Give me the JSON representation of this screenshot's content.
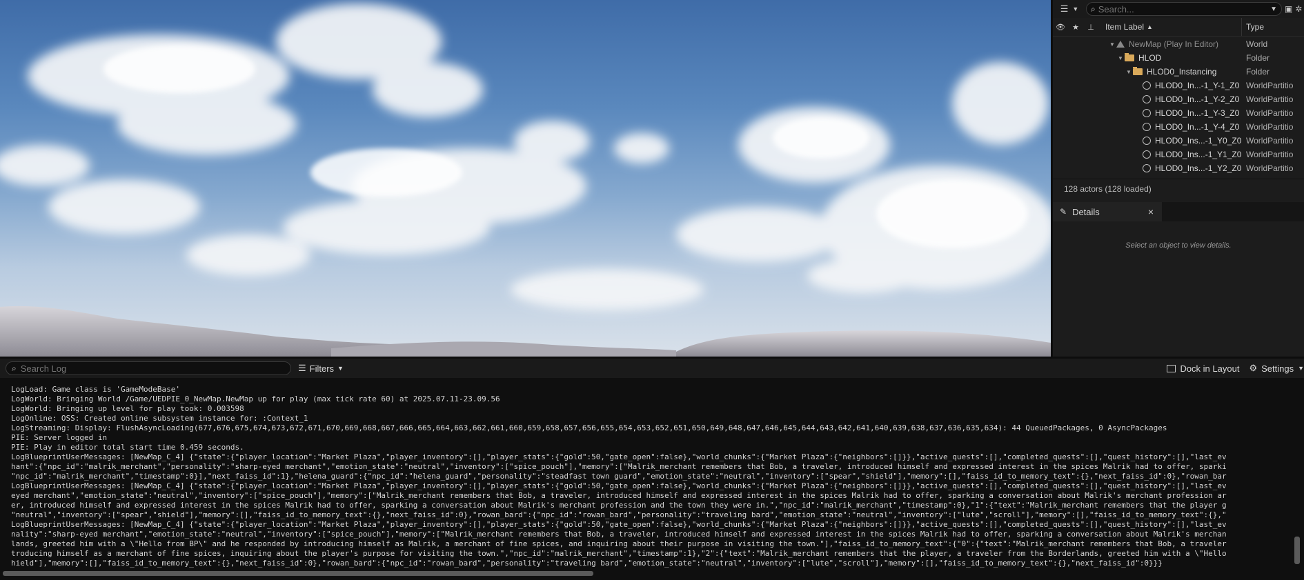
{
  "outliner": {
    "search_placeholder": "Search...",
    "columns": {
      "label": "Item Label",
      "sort_indicator": "▲",
      "type": "Type"
    },
    "rows": [
      {
        "label": "NewMap (Play In Editor)",
        "type": "World",
        "icon": "map-icon",
        "muted": true
      },
      {
        "label": "HLOD",
        "type": "Folder",
        "icon": "folder-icon"
      },
      {
        "label": "HLOD0_Instancing",
        "type": "Folder",
        "icon": "folder-icon"
      },
      {
        "label": "HLOD0_In...-1_Y-1_Z0",
        "type": "WorldPartitio",
        "icon": "hlod-actor-icon"
      },
      {
        "label": "HLOD0_In...-1_Y-2_Z0",
        "type": "WorldPartitio",
        "icon": "hlod-actor-icon"
      },
      {
        "label": "HLOD0_In...-1_Y-3_Z0",
        "type": "WorldPartitio",
        "icon": "hlod-actor-icon"
      },
      {
        "label": "HLOD0_In...-1_Y-4_Z0",
        "type": "WorldPartitio",
        "icon": "hlod-actor-icon"
      },
      {
        "label": "HLOD0_Ins...-1_Y0_Z0",
        "type": "WorldPartitio",
        "icon": "hlod-actor-icon"
      },
      {
        "label": "HLOD0_Ins...-1_Y1_Z0",
        "type": "WorldPartitio",
        "icon": "hlod-actor-icon"
      },
      {
        "label": "HLOD0_Ins...-1_Y2_Z0",
        "type": "WorldPartitio",
        "icon": "hlod-actor-icon"
      }
    ],
    "status": "128 actors (128 loaded)"
  },
  "details": {
    "tab_label": "Details",
    "close_glyph": "×",
    "empty_text": "Select an object to view details."
  },
  "log": {
    "search_placeholder": "Search Log",
    "filters_label": "Filters",
    "dock_label": "Dock in Layout",
    "settings_label": "Settings",
    "lines": [
      "LogLoad: Game class is 'GameModeBase'",
      "LogWorld: Bringing World /Game/UEDPIE_0_NewMap.NewMap up for play (max tick rate 60) at 2025.07.11-23.09.56",
      "LogWorld: Bringing up level for play took: 0.003598",
      "LogOnline: OSS: Created online subsystem instance for: :Context_1",
      "LogStreaming: Display: FlushAsyncLoading(677,676,675,674,673,672,671,670,669,668,667,666,665,664,663,662,661,660,659,658,657,656,655,654,653,652,651,650,649,648,647,646,645,644,643,642,641,640,639,638,637,636,635,634): 44 QueuedPackages, 0 AsyncPackages",
      "PIE: Server logged in",
      "PIE: Play in editor total start time 0.459 seconds.",
      "LogBlueprintUserMessages: [NewMap_C_4] {\"state\":{\"player_location\":\"Market Plaza\",\"player_inventory\":[],\"player_stats\":{\"gold\":50,\"gate_open\":false},\"world_chunks\":{\"Market Plaza\":{\"neighbors\":[]}},\"active_quests\":[],\"completed_quests\":[],\"quest_history\":[],\"last_ev",
      "hant\":{\"npc_id\":\"malrik_merchant\",\"personality\":\"sharp-eyed merchant\",\"emotion_state\":\"neutral\",\"inventory\":[\"spice_pouch\"],\"memory\":[\"Malrik_merchant remembers that Bob, a traveler, introduced himself and expressed interest in the spices Malrik had to offer, sparki",
      "\"npc_id\":\"malrik_merchant\",\"timestamp\":0}],\"next_faiss_id\":1},\"helena_guard\":{\"npc_id\":\"helena_guard\",\"personality\":\"steadfast town guard\",\"emotion_state\":\"neutral\",\"inventory\":[\"spear\",\"shield\"],\"memory\":[],\"faiss_id_to_memory_text\":{},\"next_faiss_id\":0},\"rowan_bar",
      "LogBlueprintUserMessages: [NewMap_C_4] {\"state\":{\"player_location\":\"Market Plaza\",\"player_inventory\":[],\"player_stats\":{\"gold\":50,\"gate_open\":false},\"world_chunks\":{\"Market Plaza\":{\"neighbors\":[]}},\"active_quests\":[],\"completed_quests\":[],\"quest_history\":[],\"last_ev",
      "eyed merchant\",\"emotion_state\":\"neutral\",\"inventory\":[\"spice_pouch\"],\"memory\":[\"Malrik_merchant remembers that Bob, a traveler, introduced himself and expressed interest in the spices Malrik had to offer, sparking a conversation about Malrik's merchant profession ar",
      "er, introduced himself and expressed interest in the spices Malrik had to offer, sparking a conversation about Malrik's merchant profession and the town they were in.\",\"npc_id\":\"malrik_merchant\",\"timestamp\":0},\"1\":{\"text\":\"Malrik_merchant remembers that the player g",
      "\"neutral\",\"inventory\":[\"spear\",\"shield\"],\"memory\":[],\"faiss_id_to_memory_text\":{},\"next_faiss_id\":0},\"rowan_bard\":{\"npc_id\":\"rowan_bard\",\"personality\":\"traveling bard\",\"emotion_state\":\"neutral\",\"inventory\":[\"lute\",\"scroll\"],\"memory\":[],\"faiss_id_to_memory_text\":{},\"",
      "LogBlueprintUserMessages: [NewMap_C_4] {\"state\":{\"player_location\":\"Market Plaza\",\"player_inventory\":[],\"player_stats\":{\"gold\":50,\"gate_open\":false},\"world_chunks\":{\"Market Plaza\":{\"neighbors\":[]}},\"active_quests\":[],\"completed_quests\":[],\"quest_history\":[],\"last_ev",
      "nality\":\"sharp-eyed merchant\",\"emotion_state\":\"neutral\",\"inventory\":[\"spice_pouch\"],\"memory\":[\"Malrik_merchant remembers that Bob, a traveler, introduced himself and expressed interest in the spices Malrik had to offer, sparking a conversation about Malrik's merchan",
      "lands, greeted him with a \\\"Hello from BP\\\" and he responded by introducing himself as Malrik, a merchant of fine spices, and inquiring about their purpose in visiting the town.\"],\"faiss_id_to_memory_text\":{\"0\":{\"text\":\"Malrik_merchant remembers that Bob, a traveler",
      "troducing himself as a merchant of fine spices, inquiring about the player's purpose for visiting the town.\",\"npc_id\":\"malrik_merchant\",\"timestamp\":1},\"2\":{\"text\":\"Malrik_merchant remembers that the player, a traveler from the Borderlands, greeted him with a \\\"Hello",
      "hield\"],\"memory\":[],\"faiss_id_to_memory_text\":{},\"next_faiss_id\":0},\"rowan_bard\":{\"npc_id\":\"rowan_bard\",\"personality\":\"traveling bard\",\"emotion_state\":\"neutral\",\"inventory\":[\"lute\",\"scroll\"],\"memory\":[],\"faiss_id_to_memory_text\":{},\"next_faiss_id\":0}}}"
    ]
  },
  "colors": {
    "panel_bg": "#1c1c1c",
    "log_bg": "#0f0f0f",
    "folder": "#d9a95a",
    "sky_top": "#3f6ca8"
  }
}
